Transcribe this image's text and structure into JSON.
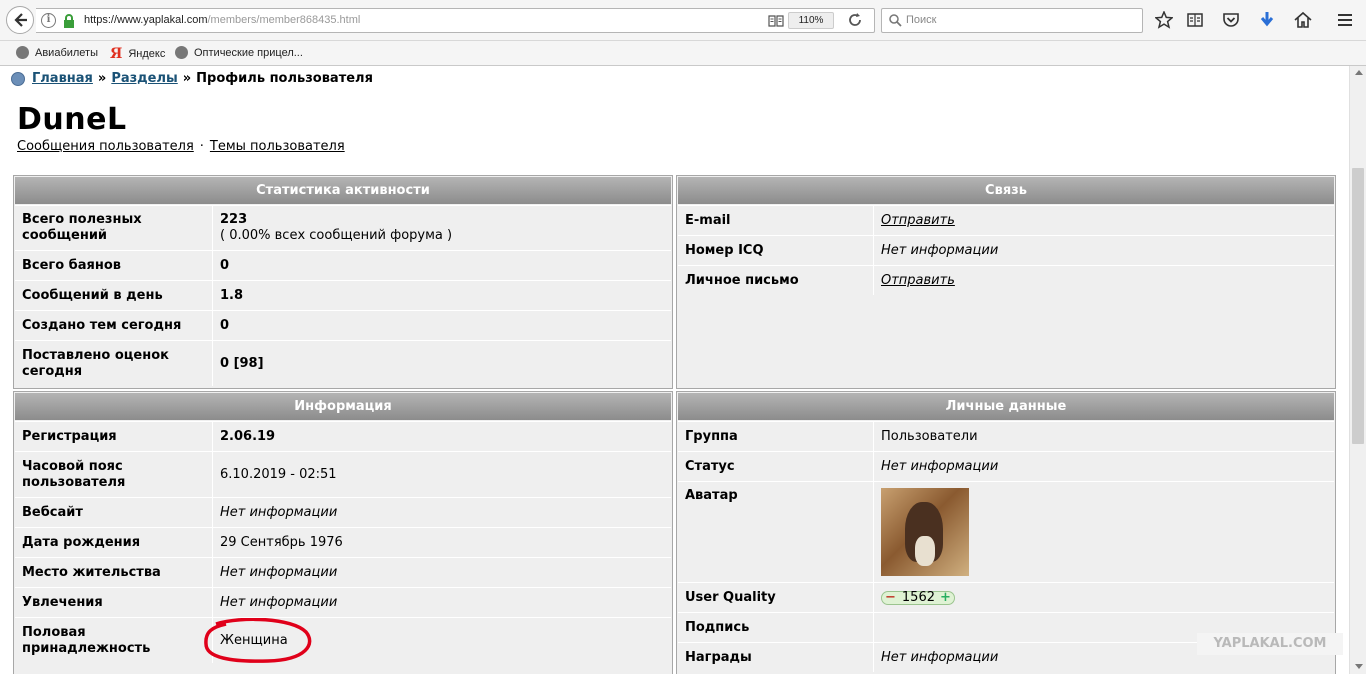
{
  "browser": {
    "url_domain": "https://www.yaplakal.com",
    "url_path": "/members/member868435.html",
    "zoom": "110%",
    "search_placeholder": "Поиск"
  },
  "bookmarks": [
    "Авиабилеты",
    "Яндекс",
    "Оптические прицел..."
  ],
  "breadcrumb": {
    "home": "Главная",
    "sep": "»",
    "sections": "Разделы",
    "current": "Профиль пользователя"
  },
  "profile": {
    "name": "DuneL",
    "link_messages": "Сообщения пользователя",
    "link_topics": "Темы пользователя",
    "dot": "·"
  },
  "activity": {
    "title": "Статистика активности",
    "rows": [
      {
        "label": "Всего полезных сообщений",
        "value": "223",
        "value2": "( 0.00% всех сообщений форума )"
      },
      {
        "label": "Всего баянов",
        "value": "0"
      },
      {
        "label": "Сообщений в день",
        "value": "1.8"
      },
      {
        "label": "Создано тем сегодня",
        "value": "0"
      },
      {
        "label": "Поставлено оценок сегодня",
        "value": "0 [98]"
      }
    ]
  },
  "contact": {
    "title": "Связь",
    "rows": [
      {
        "label": "E-mail",
        "value": "Отправить"
      },
      {
        "label": "Номер ICQ",
        "value": "Нет информации"
      },
      {
        "label": "Личное письмо",
        "value": "Отправить"
      }
    ]
  },
  "info": {
    "title": "Информация",
    "rows": [
      {
        "label": "Регистрация",
        "value": "2.06.19"
      },
      {
        "label": "Часовой пояс пользователя",
        "value": "6.10.2019 - 02:51"
      },
      {
        "label": "Вебсайт",
        "value": "Нет информации"
      },
      {
        "label": "Дата рождения",
        "value": "29 Сентябрь 1976"
      },
      {
        "label": "Место жительства",
        "value": "Нет информации"
      },
      {
        "label": "Увлечения",
        "value": "Нет информации"
      },
      {
        "label": "Половая принадлежность",
        "value": "Женщина"
      }
    ]
  },
  "personal": {
    "title": "Личные данные",
    "rows": [
      {
        "label": "Группа",
        "value": "Пользователи"
      },
      {
        "label": "Статус",
        "value": "Нет информации"
      },
      {
        "label": "Аватар",
        "value": ""
      },
      {
        "label": "User Quality",
        "value": "1562",
        "minus": "−",
        "plus": "+"
      },
      {
        "label": "Подпись",
        "value": ""
      },
      {
        "label": "Награды",
        "value": "Нет информации"
      }
    ]
  },
  "watermark": "YAPLAKAL.COM",
  "colors": {
    "header_gradient_top": "#b4b4b4",
    "header_gradient_bottom": "#8c8c8c",
    "panel_bg": "#efefef",
    "link": "#1a5276",
    "highlight": "#e0001a"
  }
}
